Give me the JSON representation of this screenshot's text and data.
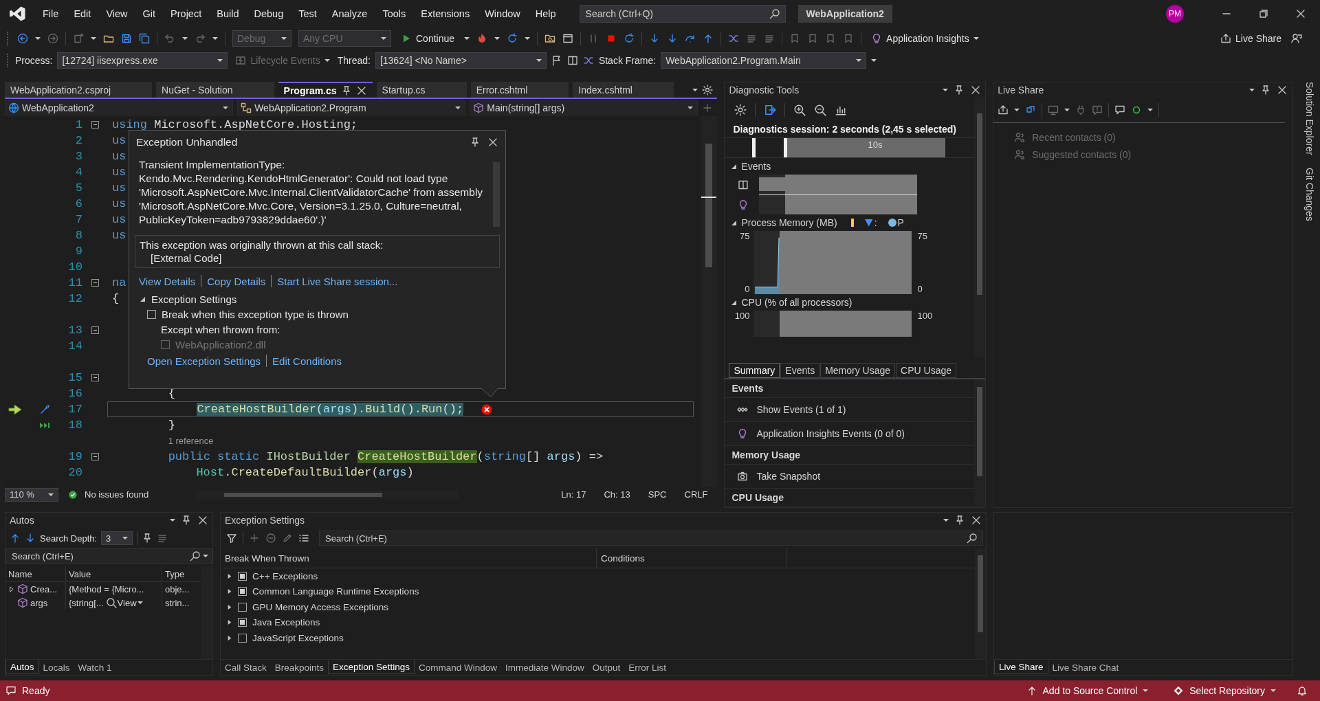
{
  "menubar": {
    "menus": [
      "File",
      "Edit",
      "View",
      "Git",
      "Project",
      "Build",
      "Debug",
      "Test",
      "Analyze",
      "Tools",
      "Extensions",
      "Window",
      "Help"
    ],
    "search": {
      "placeholder": "Search (Ctrl+Q)"
    },
    "solution": "WebApplication2",
    "avatar": "PM"
  },
  "toolbar": {
    "configuration": {
      "value": "Debug",
      "disabled": true
    },
    "platform": {
      "value": "Any CPU",
      "disabled": true
    },
    "continue": "Continue",
    "insights": "Application Insights",
    "live_share": "Live Share"
  },
  "debug_location": {
    "process_label": "Process:",
    "process": "[12724] iisexpress.exe",
    "lifecycle": {
      "label": "Lifecycle Events",
      "disabled": true
    },
    "thread_label": "Thread:",
    "thread": "[13624] <No Name>",
    "frame_label": "Stack Frame:",
    "frame": "WebApplication2.Program.Main"
  },
  "editor": {
    "tabs": [
      {
        "label": "WebApplication2.csproj",
        "selected": false
      },
      {
        "label": "NuGet - Solution",
        "selected": false
      },
      {
        "label": "Program.cs",
        "selected": true
      },
      {
        "label": "Startup.cs",
        "selected": false
      },
      {
        "label": "Error.cshtml",
        "selected": false
      },
      {
        "label": "Index.cshtml",
        "selected": false
      }
    ],
    "nav": [
      {
        "label": "WebApplication2",
        "kind": "project"
      },
      {
        "label": "WebApplication2.Program",
        "kind": "class"
      },
      {
        "label": "Main(string[] args)",
        "kind": "method"
      }
    ],
    "lines": [
      {
        "kind": "code",
        "number": "1",
        "fold": true,
        "current": false,
        "error": false,
        "run_to_click": false,
        "tokens": [
          {
            "text": "using",
            "kind": "keyword"
          },
          {
            "text": " Microsoft.AspNetCore.Hosting;",
            "kind": "plain"
          }
        ]
      },
      {
        "kind": "code",
        "number": "2",
        "fold": false,
        "current": false,
        "error": false,
        "run_to_click": false,
        "tokens": [
          {
            "text": "us",
            "kind": "keyword"
          }
        ]
      },
      {
        "kind": "code",
        "number": "3",
        "fold": false,
        "current": false,
        "error": false,
        "run_to_click": false,
        "tokens": [
          {
            "text": "us",
            "kind": "keyword"
          }
        ]
      },
      {
        "kind": "code",
        "number": "4",
        "fold": false,
        "current": false,
        "error": false,
        "run_to_click": false,
        "tokens": [
          {
            "text": "us",
            "kind": "keyword"
          }
        ]
      },
      {
        "kind": "code",
        "number": "5",
        "fold": false,
        "current": false,
        "error": false,
        "run_to_click": false,
        "tokens": [
          {
            "text": "us",
            "kind": "keyword"
          }
        ]
      },
      {
        "kind": "code",
        "number": "6",
        "fold": false,
        "current": false,
        "error": false,
        "run_to_click": false,
        "tokens": [
          {
            "text": "us",
            "kind": "keyword"
          }
        ]
      },
      {
        "kind": "code",
        "number": "7",
        "fold": false,
        "current": false,
        "error": false,
        "run_to_click": false,
        "tokens": [
          {
            "text": "us",
            "kind": "keyword"
          }
        ]
      },
      {
        "kind": "code",
        "number": "8",
        "fold": false,
        "current": false,
        "error": false,
        "run_to_click": false,
        "tokens": [
          {
            "text": "us",
            "kind": "keyword"
          }
        ]
      },
      {
        "kind": "code",
        "number": "9",
        "fold": false,
        "current": false,
        "error": false,
        "run_to_click": false
      },
      {
        "kind": "code",
        "number": "10",
        "fold": false,
        "current": false,
        "error": false,
        "run_to_click": false
      },
      {
        "kind": "code",
        "number": "11",
        "fold": true,
        "current": false,
        "error": false,
        "run_to_click": false,
        "tokens": [
          {
            "text": "na",
            "kind": "keyword"
          }
        ]
      },
      {
        "kind": "code",
        "number": "12",
        "fold": false,
        "current": false,
        "error": false,
        "run_to_click": false,
        "tokens": [
          {
            "text": "{",
            "kind": "plain"
          }
        ]
      },
      {
        "kind": "lens"
      },
      {
        "kind": "code",
        "number": "13",
        "fold": true,
        "current": false,
        "error": false,
        "run_to_click": false
      },
      {
        "kind": "code",
        "number": "14",
        "fold": false,
        "current": false,
        "error": false,
        "run_to_click": false
      },
      {
        "kind": "lens"
      },
      {
        "kind": "code",
        "number": "15",
        "fold": true,
        "current": false,
        "error": false,
        "run_to_click": false
      },
      {
        "kind": "code",
        "number": "16",
        "fold": false,
        "current": false,
        "error": false,
        "run_to_click": false,
        "tokens": [
          {
            "text": "        {",
            "kind": "plain"
          }
        ]
      },
      {
        "kind": "code",
        "number": "17",
        "fold": false,
        "current": true,
        "error": true,
        "run_to_click": false,
        "tokens": [
          {
            "text": "            CreateHostBuilder",
            "kind": "method"
          },
          {
            "text": "(",
            "kind": "plain"
          },
          {
            "text": "args",
            "kind": "parameter"
          },
          {
            "text": ").",
            "kind": "plain"
          },
          {
            "text": "Build",
            "kind": "method"
          },
          {
            "text": "().",
            "kind": "plain"
          },
          {
            "text": "Run",
            "kind": "method"
          },
          {
            "text": "();",
            "kind": "plain"
          }
        ]
      },
      {
        "kind": "code",
        "number": "18",
        "fold": false,
        "current": false,
        "error": false,
        "run_to_click": true,
        "tokens": [
          {
            "text": "        }",
            "kind": "plain"
          }
        ]
      },
      {
        "kind": "lens",
        "text": "        1 reference"
      },
      {
        "kind": "code",
        "number": "19",
        "fold": true,
        "current": false,
        "error": false,
        "run_to_click": false,
        "tokens": [
          {
            "text": "        public static",
            "kind": "keyword"
          },
          {
            "text": " IHostBuilder",
            "kind": "interface"
          },
          {
            "text": " CreateHostBuilder",
            "kind": "reference"
          },
          {
            "text": "(",
            "kind": "plain"
          },
          {
            "text": "string",
            "kind": "keyword"
          },
          {
            "text": "[] ",
            "kind": "plain"
          },
          {
            "text": "args",
            "kind": "parameter"
          },
          {
            "text": ") =>",
            "kind": "plain"
          }
        ]
      },
      {
        "kind": "code",
        "number": "20",
        "fold": false,
        "current": false,
        "error": false,
        "run_to_click": false,
        "tokens": [
          {
            "text": "            Host",
            "kind": "type"
          },
          {
            "text": ".",
            "kind": "plain"
          },
          {
            "text": "CreateDefaultBuilder",
            "kind": "method"
          },
          {
            "text": "(",
            "kind": "plain"
          },
          {
            "text": "args",
            "kind": "parameter"
          },
          {
            "text": ")",
            "kind": "plain"
          }
        ]
      }
    ],
    "popup": {
      "title": "Exception Unhandled",
      "message": "Transient ImplementationType: Kendo.Mvc.Rendering.KendoHtmlGenerator': Could not load type 'Microsoft.AspNetCore.Mvc.Internal.ClientValidatorCache' from assembly 'Microsoft.AspNetCore.Mvc.Core, Version=3.1.25.0, Culture=neutral, PublicKeyToken=adb9793829ddae60'.)'",
      "stack_heading": "This exception was originally thrown at this call stack:",
      "stack": [
        "[External Code]"
      ],
      "links": [
        "View Details",
        "Copy Details",
        "Start Live Share session..."
      ],
      "settings_title": "Exception Settings",
      "settings_expanded": true,
      "break_option": {
        "label": "Break when this exception type is thrown",
        "checked": false
      },
      "except_label": "Except when thrown from:",
      "modules": [
        {
          "label": "WebApplication2.dll",
          "checked": false,
          "disabled": true
        }
      ],
      "settings_links": [
        "Open Exception Settings",
        "Edit Conditions"
      ]
    },
    "status": {
      "zoom": "110 %",
      "issues": "No issues found",
      "ln": "Ln: 17",
      "ch": "Ch: 13",
      "indent": "SPC",
      "eol": "CRLF"
    }
  },
  "diagnostics": {
    "title": "Diagnostic Tools",
    "session": "Diagnostics session: 2 seconds (2,45 s selected)",
    "timeline_label": "10s",
    "events_title": "Events",
    "memory": {
      "title": "Process Memory (MB)",
      "legend": [
        {
          "kind": "snapshot"
        },
        {
          "kind": "gc",
          "label": ":"
        },
        {
          "kind": "private",
          "label": "P"
        }
      ],
      "left_ticks": [
        "75",
        "0"
      ],
      "right_ticks": [
        "75",
        "0"
      ]
    },
    "cpu": {
      "title": "CPU (% of all processors)",
      "left_ticks": [
        "100"
      ],
      "right_ticks": [
        "100"
      ]
    },
    "tabs": [
      {
        "label": "Summary",
        "selected": true
      },
      {
        "label": "Events",
        "selected": false
      },
      {
        "label": "Memory Usage",
        "selected": false
      },
      {
        "label": "CPU Usage",
        "selected": false
      }
    ],
    "sections": [
      {
        "title": "Events",
        "items": [
          {
            "label": "Show Events (1 of 1)",
            "kind": "events"
          },
          {
            "label": "Application Insights Events (0 of 0)",
            "kind": "insights"
          }
        ]
      },
      {
        "title": "Memory Usage",
        "items": [
          {
            "label": "Take Snapshot",
            "kind": "snapshot"
          }
        ]
      },
      {
        "title": "CPU Usage"
      }
    ]
  },
  "live_share": {
    "title": "Live Share",
    "contacts": [
      "Recent contacts (0)",
      "Suggested contacts (0)"
    ]
  },
  "side_tabs": [
    "Solution Explorer",
    "Git Changes"
  ],
  "autos": {
    "title": "Autos",
    "depth_label": "Search Depth:",
    "depth": "3",
    "search": {
      "placeholder": "Search (Ctrl+E)"
    },
    "columns": [
      "Name",
      "Value",
      "Type"
    ],
    "rows": [
      {
        "name": "Crea...",
        "value": "{Method = {Micro...",
        "type": "obje...",
        "expandable": true
      },
      {
        "name": "args",
        "value": "{string[...",
        "view": "View",
        "type": "strin...",
        "expandable": false
      }
    ],
    "tabs": [
      {
        "label": "Autos",
        "selected": true
      },
      {
        "label": "Locals",
        "selected": false
      },
      {
        "label": "Watch 1",
        "selected": false
      }
    ]
  },
  "exception_settings": {
    "title": "Exception Settings",
    "search": {
      "placeholder": "Search (Ctrl+E)"
    },
    "columns": [
      "Break When Thrown",
      "Conditions"
    ],
    "rows": [
      {
        "label": "C++ Exceptions",
        "checked": true
      },
      {
        "label": "Common Language Runtime Exceptions",
        "checked": true
      },
      {
        "label": "GPU Memory Access Exceptions",
        "checked": false
      },
      {
        "label": "Java Exceptions",
        "checked": true
      },
      {
        "label": "JavaScript Exceptions",
        "checked": false
      }
    ],
    "tabs": [
      {
        "label": "Call Stack",
        "selected": false
      },
      {
        "label": "Breakpoints",
        "selected": false
      },
      {
        "label": "Exception Settings",
        "selected": true
      },
      {
        "label": "Command Window",
        "selected": false
      },
      {
        "label": "Immediate Window",
        "selected": false
      },
      {
        "label": "Output",
        "selected": false
      },
      {
        "label": "Error List",
        "selected": false
      }
    ]
  },
  "live_share_bottom": {
    "tabs": [
      {
        "label": "Live Share",
        "selected": true
      },
      {
        "label": "Live Share Chat",
        "selected": false
      }
    ]
  },
  "status_bar": {
    "text": "Ready",
    "source_control": "Add to Source Control",
    "repository": "Select Repository"
  }
}
